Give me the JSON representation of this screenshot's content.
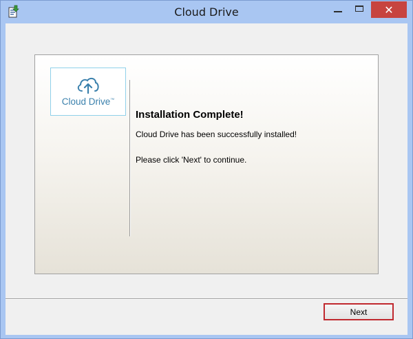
{
  "window": {
    "title": "Cloud Drive",
    "close_glyph": "✕",
    "icons": {
      "app": "installer-icon",
      "minimize": "minimize-icon",
      "maximize": "maximize-icon",
      "close": "close-icon"
    },
    "colors": {
      "titlebar": "#a9c6f2",
      "close": "#c7443f"
    }
  },
  "logo": {
    "text": "Cloud Drive",
    "trademark": "™",
    "icon": "cloud-upload-icon",
    "color": "#3a80ac"
  },
  "content": {
    "heading": "Installation Complete!",
    "message": "Cloud Drive has been successfully installed!",
    "instruction": "Please click 'Next' to continue."
  },
  "footer": {
    "next_label": "Next",
    "accent": "#c0282e"
  }
}
